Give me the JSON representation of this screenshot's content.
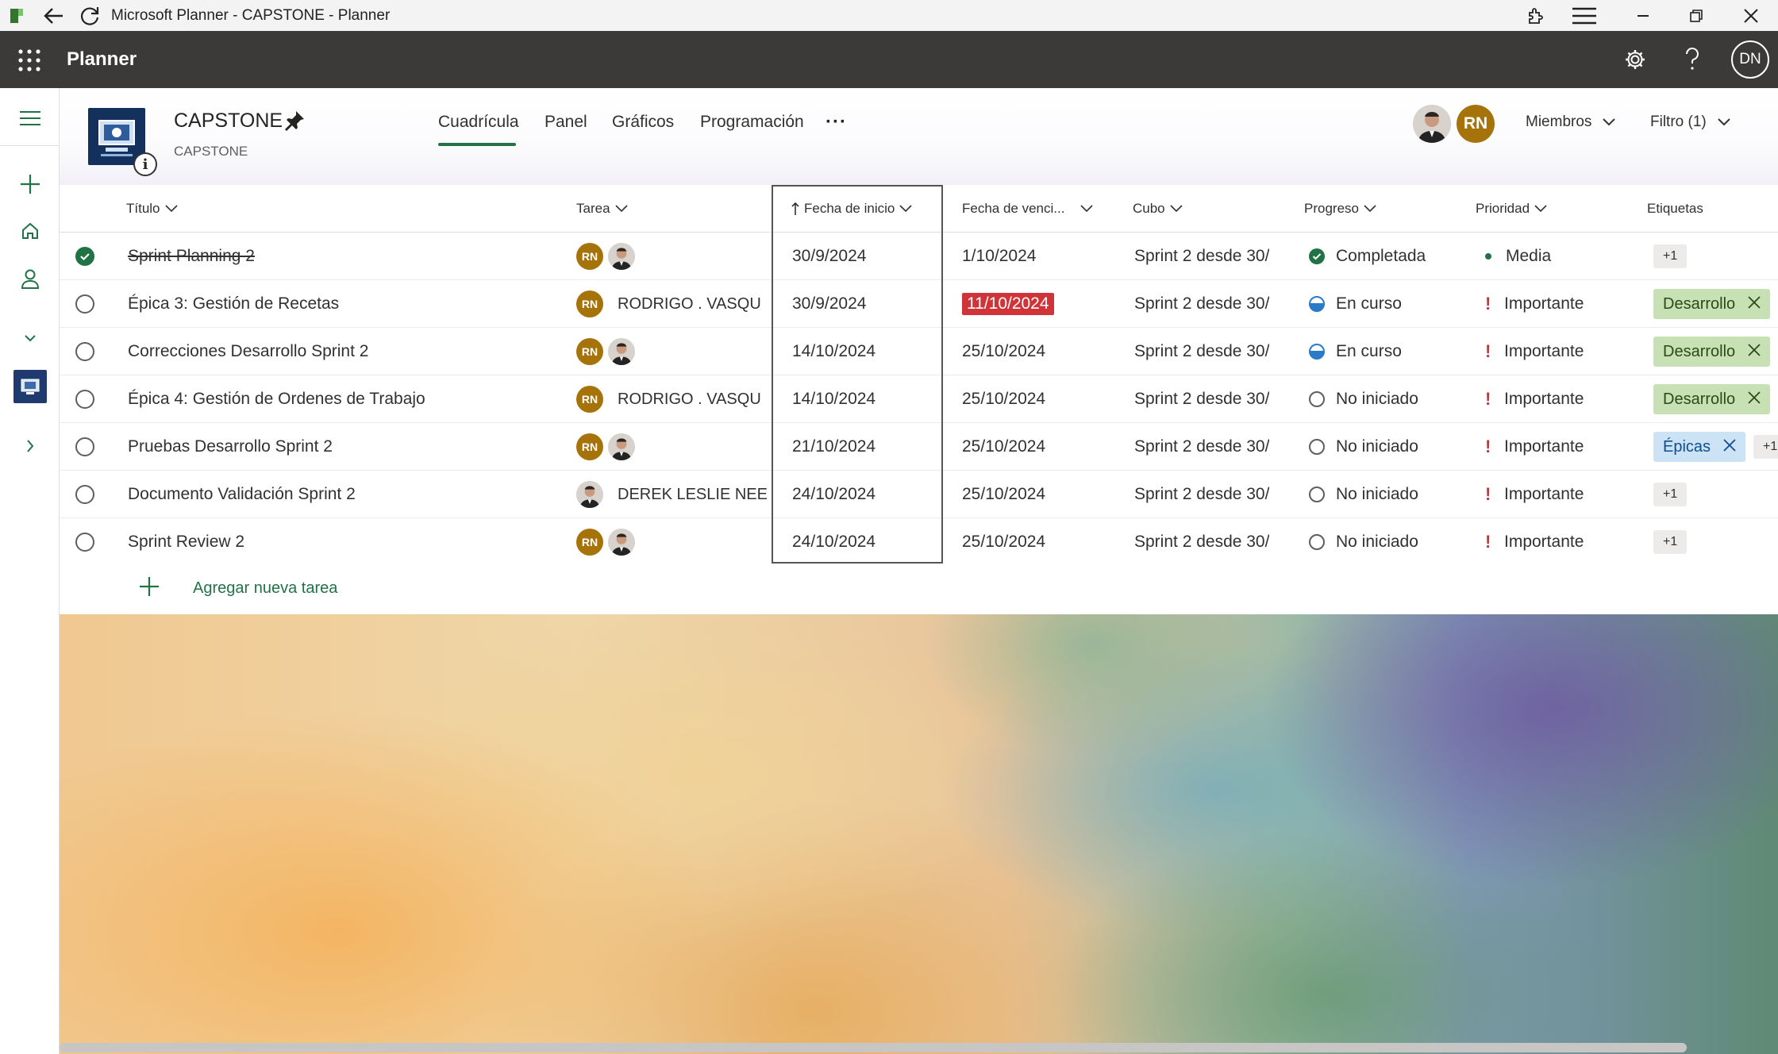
{
  "window": {
    "title": "Microsoft Planner - CAPSTONE - Planner"
  },
  "app": {
    "name": "Planner",
    "user_initials": "DN"
  },
  "plan": {
    "name": "CAPSTONE",
    "group": "CAPSTONE",
    "info_glyph": "i"
  },
  "tabs": [
    {
      "label": "Cuadrícula",
      "active": true
    },
    {
      "label": "Panel",
      "active": false
    },
    {
      "label": "Gráficos",
      "active": false
    },
    {
      "label": "Programación",
      "active": false
    }
  ],
  "tabs_more": "···",
  "members": {
    "avatar_initials": "RN",
    "label": "Miembros"
  },
  "filter": {
    "label": "Filtro (1)"
  },
  "columns": {
    "title": "Título",
    "assigned": "Tarea",
    "start": "Fecha de inicio",
    "due": "Fecha de venci...",
    "bucket": "Cubo",
    "progress": "Progreso",
    "priority": "Prioridad",
    "labels": "Etiquetas"
  },
  "tasks": [
    {
      "title": "Sprint Planning 2",
      "done": true,
      "assignee_initials": "RN",
      "assignee_name": "",
      "start": "30/9/2024",
      "due": "1/10/2024",
      "due_overdue": false,
      "bucket": "Sprint 2 desde 30/",
      "progress": "Completada",
      "priority": "Media",
      "label": "+1"
    },
    {
      "title": "Épica 3: Gestión de Recetas",
      "done": false,
      "assignee_initials": "RN",
      "assignee_name": "RODRIGO . VASQU",
      "start": "30/9/2024",
      "due": "11/10/2024",
      "due_overdue": true,
      "bucket": "Sprint 2 desde 30/",
      "progress": "En curso",
      "priority": "Importante",
      "label": "Desarrollo"
    },
    {
      "title": "Correcciones Desarrollo Sprint 2",
      "done": false,
      "assignee_initials": "RN",
      "assignee_name": "",
      "start": "14/10/2024",
      "due": "25/10/2024",
      "due_overdue": false,
      "bucket": "Sprint 2 desde 30/",
      "progress": "En curso",
      "priority": "Importante",
      "label": "Desarrollo"
    },
    {
      "title": "Épica 4: Gestión de Ordenes de Trabajo",
      "done": false,
      "assignee_initials": "RN",
      "assignee_name": "RODRIGO . VASQU",
      "start": "14/10/2024",
      "due": "25/10/2024",
      "due_overdue": false,
      "bucket": "Sprint 2 desde 30/",
      "progress": "No iniciado",
      "priority": "Importante",
      "label": "Desarrollo"
    },
    {
      "title": "Pruebas Desarrollo Sprint 2",
      "done": false,
      "assignee_initials": "RN",
      "assignee_name": "",
      "start": "21/10/2024",
      "due": "25/10/2024",
      "due_overdue": false,
      "bucket": "Sprint 2 desde 30/",
      "progress": "No iniciado",
      "priority": "Importante",
      "label": "Épicas",
      "label_more": "+1"
    },
    {
      "title": "Documento Validación Sprint 2",
      "done": false,
      "assignee_initials": "",
      "assignee_name": "DEREK LESLIE NEEI",
      "start": "24/10/2024",
      "due": "25/10/2024",
      "due_overdue": false,
      "bucket": "Sprint 2 desde 30/",
      "progress": "No iniciado",
      "priority": "Importante",
      "label": "+1"
    },
    {
      "title": "Sprint Review 2",
      "done": false,
      "assignee_initials": "RN",
      "assignee_name": "",
      "start": "24/10/2024",
      "due": "25/10/2024",
      "due_overdue": false,
      "bucket": "Sprint 2 desde 30/",
      "progress": "No iniciado",
      "priority": "Importante",
      "label": "+1"
    }
  ],
  "add_task": "Agregar nueva tarea",
  "colors": {
    "accent": "#217346",
    "appbar": "#3b3a39",
    "overdue": "#d13438",
    "label_green": "#c7e0b4",
    "label_blue": "#cce2f5",
    "avatar_rn": "#a6720a"
  }
}
